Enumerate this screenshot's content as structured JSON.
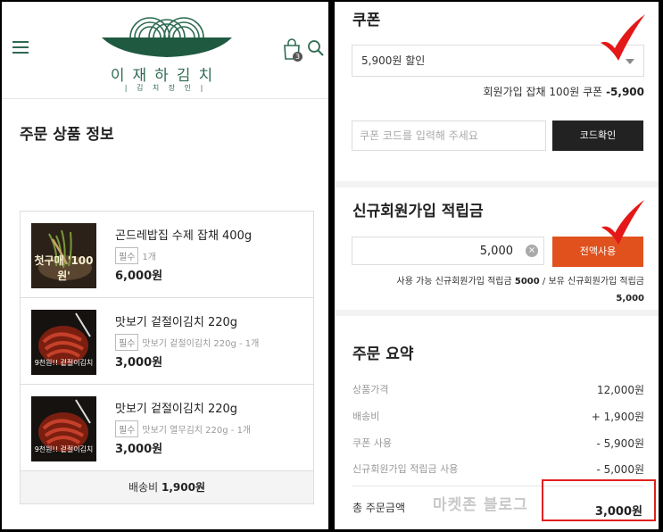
{
  "brand": {
    "name": "이재하김치",
    "tagline": "| 김 치 장 인 |"
  },
  "header": {
    "cart_count": "3"
  },
  "order_info": {
    "title": "주문 상품 정보",
    "items": [
      {
        "name": "곤드레밥집 수제 잡채 400g",
        "badge": "필수",
        "option": "1개",
        "price": "6,000원",
        "thumb_text": "첫구매 '100원'"
      },
      {
        "name": "맛보기 겉절이김치 220g",
        "badge": "필수",
        "option": "맛보기 겉절이김치 220g - 1개",
        "price": "3,000원",
        "thumb_text": "9천원!! 겉절이김치"
      },
      {
        "name": "맛보기 겉절이김치 220g",
        "badge": "필수",
        "option": "맛보기 열무김치 220g - 1개",
        "price": "3,000원",
        "thumb_text": "9천원!! 겉절이김치"
      }
    ],
    "shipping_label": "배송비",
    "shipping_value": "1,900원"
  },
  "coupon": {
    "title": "쿠폰",
    "selected": "5,900원 할인",
    "applied_label": "회원가입 잡채 100원 쿠폰",
    "applied_value": "-5,900",
    "code_placeholder": "쿠폰 코드를 입력해 주세요",
    "code_button": "코드확인"
  },
  "points": {
    "title": "신규회원가입 적립금",
    "value": "5,000",
    "use_all_button": "전액사용",
    "avail_prefix": "사용 가능 신규회원가입 적립금",
    "avail_value": "5000",
    "own_prefix": "/ 보유 신규회원가입 적립금",
    "own_value": "5,000"
  },
  "summary": {
    "title": "주문 요약",
    "rows": [
      {
        "label": "상품가격",
        "value": "12,000원"
      },
      {
        "label": "배송비",
        "value": "+ 1,900원"
      },
      {
        "label": "쿠폰 사용",
        "value": "- 5,900원"
      },
      {
        "label": "신규회원가입 적립금 사용",
        "value": "- 5,000원"
      }
    ],
    "total_label": "총 주문금액",
    "total_value": "3,000원"
  },
  "watermark": "마켓존 블로그",
  "colors": {
    "brand_green": "#2e6b52",
    "accent_orange": "#e0511d",
    "check_red": "#e41818",
    "highlight_red": "#e02020"
  }
}
